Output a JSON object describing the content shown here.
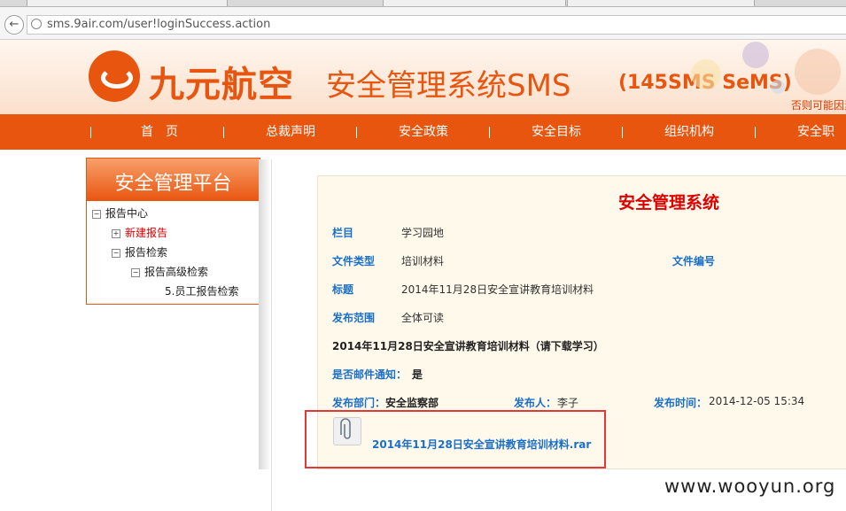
{
  "browser": {
    "url": "sms.9air.com/user!loginSuccess.action",
    "back_label": "←"
  },
  "banner": {
    "brand": "九元航空",
    "title": "安全管理系统SMS",
    "subtitle": "(145SMS SeMS)",
    "notice": "否则可能因素"
  },
  "nav": [
    "首　页",
    "总裁声明",
    "安全政策",
    "安全目标",
    "组织机构",
    "安全职责"
  ],
  "sidebar": {
    "title": "安全管理平台",
    "items": [
      {
        "label": "报告中心",
        "toggle": "−"
      },
      {
        "label": "新建报告",
        "toggle": "+"
      },
      {
        "label": "报告检索",
        "toggle": "−"
      },
      {
        "label": "报告高级检索",
        "toggle": "−"
      },
      {
        "label": "5.员工报告检索",
        "toggle": ""
      }
    ]
  },
  "detail": {
    "title": "安全管理系统",
    "column_label": "栏目",
    "column_value": "学习园地",
    "filetype_label": "文件类型",
    "filetype_value": "培训材料",
    "fileno_label": "文件编号",
    "subject_label": "标题",
    "subject_value": "2014年11月28日安全宣讲教育培训材料",
    "scope_label": "发布范围",
    "scope_value": "全体可读",
    "body": "2014年11月28日安全宣讲教育培训材料（请下载学习）",
    "email_label": "是否邮件通知：",
    "email_value": "是",
    "dept_label": "发布部门：",
    "dept_value": "安全监察部",
    "publisher_label": "发布人：",
    "publisher_value": "李子",
    "time_label": "发布时间：",
    "time_value": "2014-12-05 15:34",
    "attachment": "2014年11月28日安全宣讲教育培训材料.rar"
  },
  "watermark": "www.wooyun.org"
}
